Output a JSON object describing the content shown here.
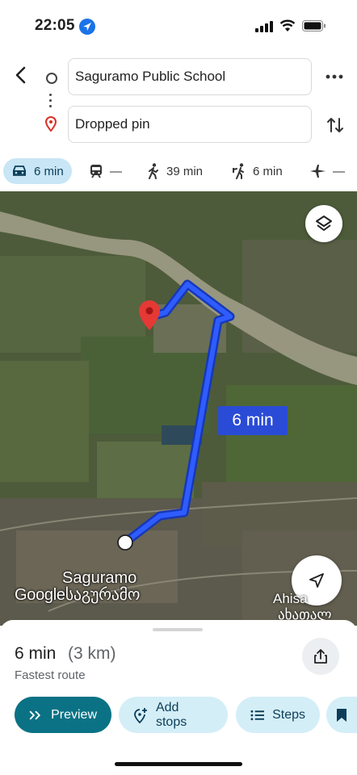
{
  "status_bar": {
    "time": "22:05",
    "icons": [
      "location-arrow-icon",
      "signal-icon",
      "wifi-icon",
      "battery-icon"
    ]
  },
  "directions": {
    "origin": "Saguramo Public School",
    "destination": "Dropped pin"
  },
  "modes": [
    {
      "name": "drive",
      "icon": "car-icon",
      "label": "6 min",
      "active": true
    },
    {
      "name": "transit",
      "icon": "train-icon",
      "label": "—"
    },
    {
      "name": "walk",
      "icon": "walk-icon",
      "label": "39 min"
    },
    {
      "name": "ride",
      "icon": "ride-icon",
      "label": "6 min"
    },
    {
      "name": "flight",
      "icon": "plane-icon",
      "label": "—"
    }
  ],
  "map": {
    "route_label": "6 min",
    "place_label": "Saguramo",
    "attribution": "Google",
    "local_label": "საგურამო",
    "place_label_2": "Ahisa",
    "local_label_2": "ახათალ"
  },
  "sheet": {
    "duration": "6 min",
    "distance": "(3 km)",
    "route_description": "Fastest route",
    "actions": {
      "preview": "Preview",
      "add_stops": "Add stops",
      "steps": "Steps"
    }
  },
  "colors": {
    "accent": "#0b7285",
    "route": "#2a4bd6",
    "chip": "#d4eef7",
    "active_mode": "#c8e6f5",
    "pin": "#e53935"
  }
}
